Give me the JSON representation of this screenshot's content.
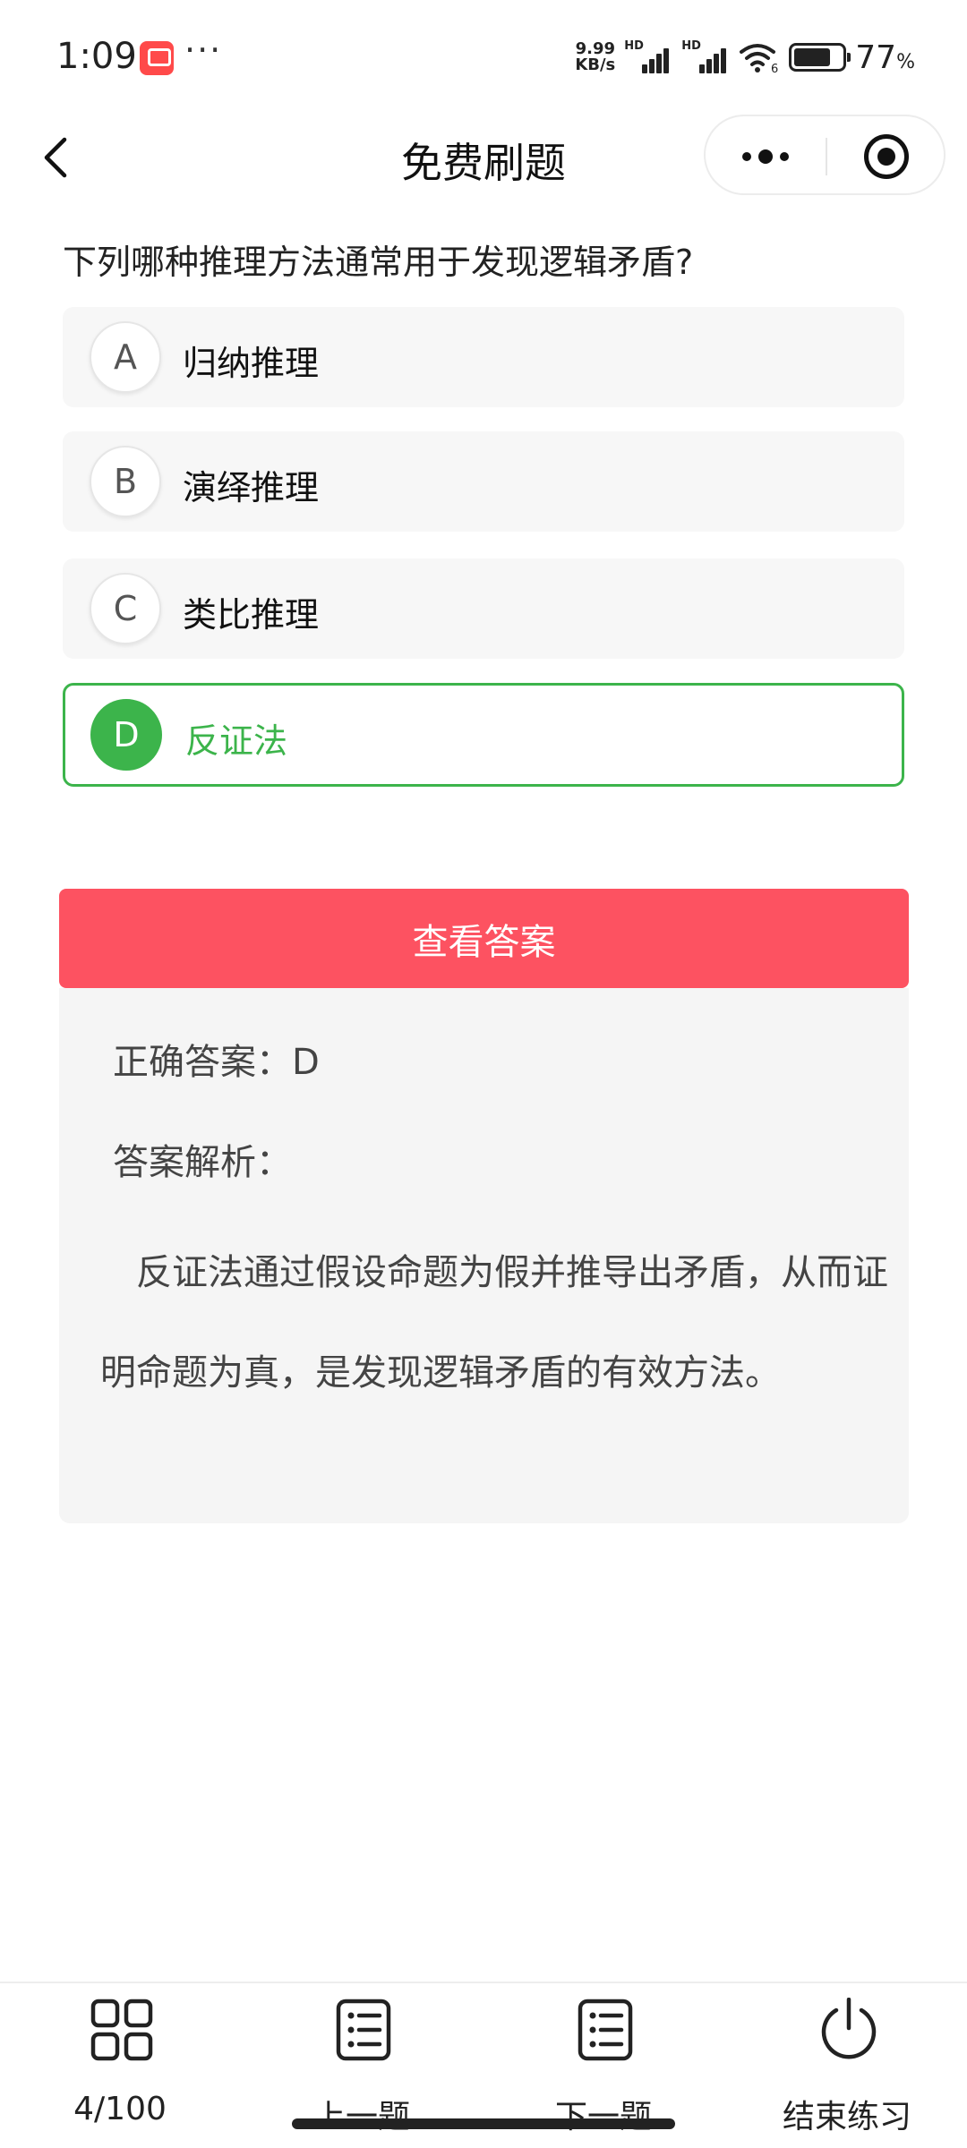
{
  "status_bar": {
    "time": "1:09",
    "more": "···",
    "net_speed_value": "9.99",
    "net_speed_unit": "KB/s",
    "signal_label_1": "HD",
    "signal_label_2": "HD",
    "wifi_badge": "6",
    "battery_percent": 0.77,
    "battery_value": "77",
    "battery_unit": "%"
  },
  "nav": {
    "title": "免费刷题"
  },
  "question": {
    "text": "下列哪种推理方法通常用于发现逻辑矛盾?",
    "options": [
      {
        "letter": "A",
        "text": "归纳推理",
        "selected": false
      },
      {
        "letter": "B",
        "text": "演绎推理",
        "selected": false
      },
      {
        "letter": "C",
        "text": "类比推理",
        "selected": false
      },
      {
        "letter": "D",
        "text": "反证法",
        "selected": true
      }
    ]
  },
  "show_answer_label": "查看答案",
  "answer": {
    "correct": "正确答案：D",
    "analysis_label": "答案解析：",
    "analysis_text": "反证法通过假设命题为假并推导出矛盾，从而证明命题为真，是发现逻辑矛盾的有效方法。"
  },
  "tabbar": {
    "progress": "4/100",
    "prev": "上一题",
    "next": "下一题",
    "end": "结束练习"
  },
  "colors": {
    "accent_green": "#3cb44b",
    "button_red": "#fd5261"
  },
  "icons": {
    "back": "chevron-left-icon",
    "more": "more-dots-icon",
    "close": "target-circle-icon",
    "grid": "grid-icon",
    "prev": "list-icon",
    "next": "list-icon",
    "end": "power-icon"
  }
}
